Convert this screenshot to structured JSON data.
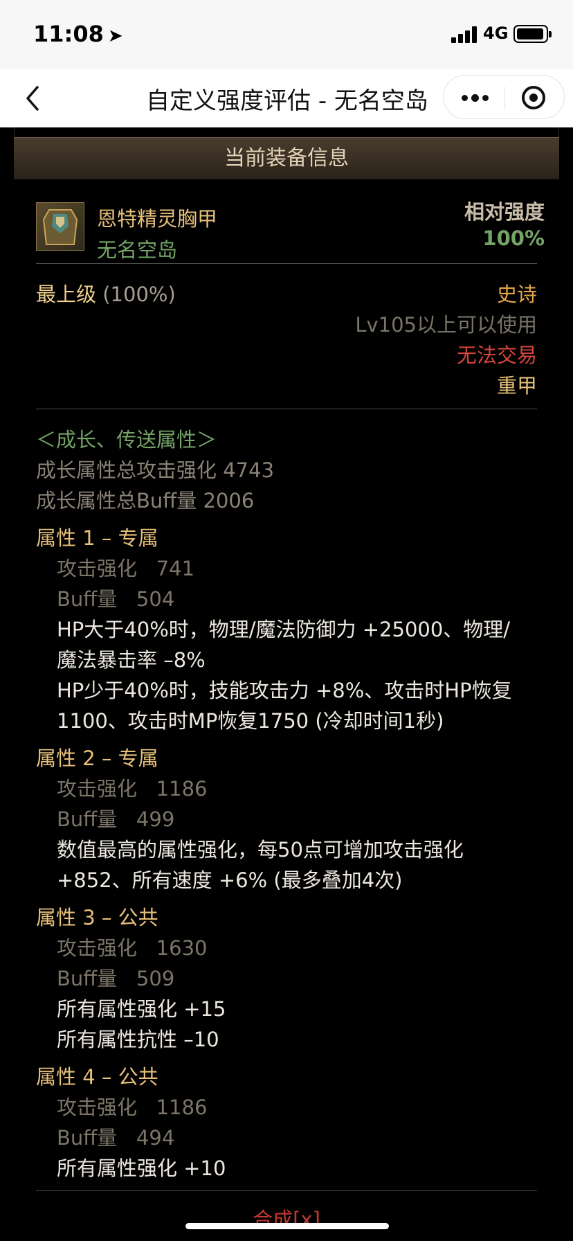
{
  "status": {
    "time": "11:08",
    "network": "4G"
  },
  "nav": {
    "title": "自定义强度评估 - 无名空岛"
  },
  "section": {
    "title": "当前装备信息"
  },
  "item": {
    "name": "恩特精灵胸甲",
    "server": "无名空岛",
    "strength_label": "相对强度",
    "strength_value": "100%",
    "grade_label": "最上级",
    "grade_pct": "(100%)",
    "rarity": "史诗",
    "level_req": "Lv105以上可以使用",
    "trade": "无法交易",
    "armor_type": "重甲"
  },
  "growth": {
    "header": "＜成长、传送属性＞",
    "total_atk": "成长属性总攻击强化 4743",
    "total_buff": "成长属性总Buff量 2006"
  },
  "attributes": [
    {
      "title": "属性 1 – 专属",
      "atk_label": "攻击强化",
      "atk_value": "741",
      "buff_label": "Buff量",
      "buff_value": "504",
      "effects": [
        "HP大于40%时，物理/魔法防御力 +25000、物理/",
        "魔法暴击率 –8%",
        "HP少于40%时，技能攻击力 +8%、攻击时HP恢复",
        "1100、攻击时MP恢复1750 (冷却时间1秒)"
      ]
    },
    {
      "title": "属性 2 – 专属",
      "atk_label": "攻击强化",
      "atk_value": "1186",
      "buff_label": "Buff量",
      "buff_value": "499",
      "effects": [
        "数值最高的属性强化，每50点可增加攻击强化",
        "+852、所有速度 +6% (最多叠加4次)"
      ]
    },
    {
      "title": "属性 3 – 公共",
      "atk_label": "攻击强化",
      "atk_value": "1630",
      "buff_label": "Buff量",
      "buff_value": "509",
      "effects": [
        "所有属性强化 +15",
        "所有属性抗性 –10"
      ]
    },
    {
      "title": "属性 4 – 公共",
      "atk_label": "攻击强化",
      "atk_value": "1186",
      "buff_label": "Buff量",
      "buff_value": "494",
      "effects": [
        "所有属性强化 +10"
      ]
    }
  ],
  "footer": {
    "synth": "合成[x]"
  }
}
